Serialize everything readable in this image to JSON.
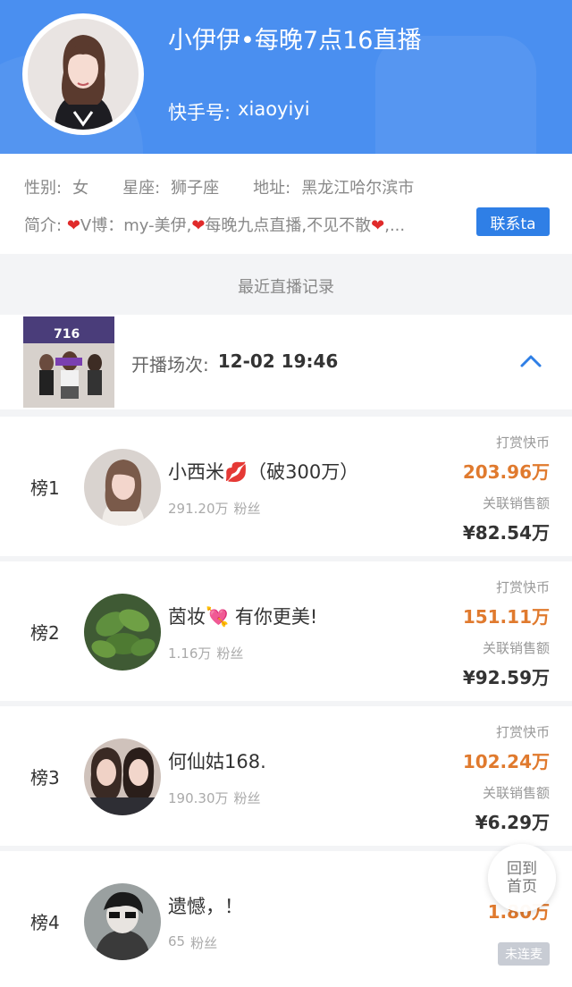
{
  "anchor": {
    "name": "小伊伊•每晚7点16直播",
    "id_label": "快手号:",
    "id_value": "xiaoyiyi"
  },
  "info": {
    "gender_label": "性别:",
    "gender_value": "女",
    "zodiac_label": "星座:",
    "zodiac_value": "狮子座",
    "address_label": "地址:",
    "address_value": "黑龙江哈尔滨市",
    "bio_label": "简介:",
    "bio_part1": "V博：my-美伊,",
    "bio_part2": "每晚九点直播,不见不散",
    "bio_ellipsis": ",...",
    "contact_button": "联系ta"
  },
  "section_title": "最近直播记录",
  "live_record": {
    "thumb_text": "716",
    "label": "开播场次:",
    "time": "12-02 19:46"
  },
  "coin_label": "打赏快币",
  "sales_label": "关联销售额",
  "fans_suffix": "粉丝",
  "rankings": [
    {
      "rank": "榜1",
      "name": "小西米💋（破300万）",
      "fans": "291.20万",
      "coins": "203.96万",
      "sales": "¥82.54万"
    },
    {
      "rank": "榜2",
      "name": "茵妆💘 有你更美!",
      "fans": "1.16万",
      "coins": "151.11万",
      "sales": "¥92.59万"
    },
    {
      "rank": "榜3",
      "name": "何仙姑168.",
      "fans": "190.30万",
      "coins": "102.24万",
      "sales": "¥6.29万"
    },
    {
      "rank": "榜4",
      "name": "遗憾，！",
      "fans": "65",
      "coins": "1.80万",
      "badge": "未连麦"
    }
  ],
  "home_button": {
    "line1": "回到",
    "line2": "首页"
  },
  "colors": {
    "header_blue": "#4a8ff0",
    "button_blue": "#2f7fe6",
    "coin_orange": "#e07a2e"
  },
  "icons": [
    "heart-icon",
    "chevron-up-icon"
  ]
}
